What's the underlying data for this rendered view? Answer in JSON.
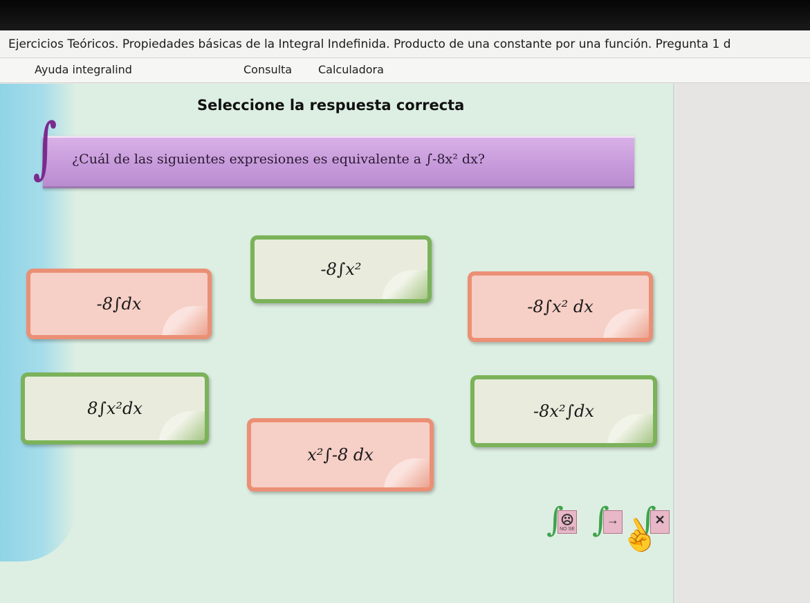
{
  "window": {
    "title": "Ejercicios Teóricos. Propiedades básicas de la Integral Indefinida. Producto de una constante por una función. Pregunta 1 d"
  },
  "menu": {
    "items": [
      "Ayuda integralind",
      "Consulta",
      "Calculadora"
    ]
  },
  "heading": "Seleccione la respuesta correcta",
  "question": "¿Cuál de las siguientes expresiones es equivalente a ∫-8x² dx?",
  "options": [
    {
      "label": "-8∫x²",
      "color": "green"
    },
    {
      "label": "-8∫dx",
      "color": "red"
    },
    {
      "label": "-8∫x² dx",
      "color": "red"
    },
    {
      "label": "8∫x²dx",
      "color": "green"
    },
    {
      "label": "-8x²∫dx",
      "color": "green"
    },
    {
      "label": "x²∫-8 dx",
      "color": "red"
    }
  ],
  "buttons": {
    "dont_know": {
      "glyph": "☹",
      "sublabel": "NO SE",
      "icon": "sad-face-icon"
    },
    "next": {
      "glyph": "→",
      "icon": "arrow-right-icon"
    },
    "close": {
      "glyph": "✕",
      "icon": "close-icon"
    }
  },
  "colors": {
    "green_border": "#7bb25a",
    "red_border": "#eb8f75",
    "question_bar": "#c79bdb",
    "background": "#ddefe2"
  }
}
